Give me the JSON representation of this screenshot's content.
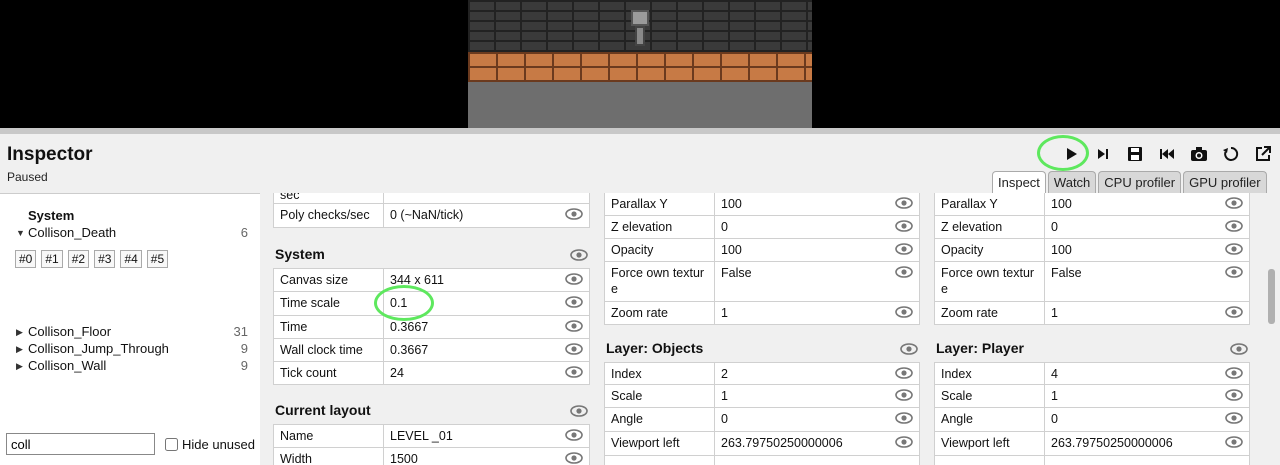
{
  "inspector": {
    "title": "Inspector",
    "status": "Paused"
  },
  "toolbar": {
    "buttons": [
      "play-icon",
      "step-icon",
      "save-icon",
      "restore-icon",
      "camera-icon",
      "reload-icon",
      "popout-icon"
    ]
  },
  "tabs": [
    "Inspect",
    "Watch",
    "CPU profiler",
    "GPU profiler"
  ],
  "tree": {
    "heading": "System",
    "expanded": {
      "label": "Collison_Death",
      "count": "6"
    },
    "instances": [
      "#0",
      "#1",
      "#2",
      "#3",
      "#4",
      "#5"
    ],
    "collapsed": [
      {
        "label": "Collison_Floor",
        "count": "31"
      },
      {
        "label": "Collison_Jump_Through",
        "count": "9"
      },
      {
        "label": "Collison_Wall",
        "count": "9"
      }
    ]
  },
  "filter": {
    "value": "coll",
    "hide_unused": "Hide unused"
  },
  "mid": {
    "top_rows": [
      {
        "k": "sec",
        "v": ""
      },
      {
        "k": "Poly checks/sec",
        "v": "0 (~NaN/tick)"
      }
    ],
    "system_title": "System",
    "system_rows": [
      {
        "k": "Canvas size",
        "v": "344 x 611"
      },
      {
        "k": "Time scale",
        "v": "0.1"
      },
      {
        "k": "Time",
        "v": "0.3667"
      },
      {
        "k": "Wall clock time",
        "v": "0.3667"
      },
      {
        "k": "Tick count",
        "v": "24"
      }
    ],
    "layout_title": "Current layout",
    "layout_rows": [
      {
        "k": "Name",
        "v": "LEVEL _01"
      },
      {
        "k": "Width",
        "v": "1500"
      }
    ]
  },
  "objects": {
    "top_rows": [
      {
        "k": "Parallax Y",
        "v": "100"
      },
      {
        "k": "Z elevation",
        "v": "0"
      },
      {
        "k": "Opacity",
        "v": "100"
      },
      {
        "k": "Force own textur e",
        "v": "False"
      },
      {
        "k": "Zoom rate",
        "v": "1"
      }
    ],
    "title": "Layer: Objects",
    "rows": [
      {
        "k": "Index",
        "v": "2"
      },
      {
        "k": "Scale",
        "v": "1"
      },
      {
        "k": "Angle",
        "v": "0"
      },
      {
        "k": "Viewport left",
        "v": "263.79750250000006"
      }
    ]
  },
  "player": {
    "top_rows": [
      {
        "k": "Parallax Y",
        "v": "100"
      },
      {
        "k": "Z elevation",
        "v": "0"
      },
      {
        "k": "Opacity",
        "v": "100"
      },
      {
        "k": "Force own textur e",
        "v": "False"
      },
      {
        "k": "Zoom rate",
        "v": "1"
      }
    ],
    "title": "Layer: Player",
    "rows": [
      {
        "k": "Index",
        "v": "4"
      },
      {
        "k": "Scale",
        "v": "1"
      },
      {
        "k": "Angle",
        "v": "0"
      },
      {
        "k": "Viewport left",
        "v": "263.79750250000006"
      }
    ]
  },
  "colors": {
    "highlight": "#5ee85e",
    "panel_bg": "#f0f0f0"
  }
}
